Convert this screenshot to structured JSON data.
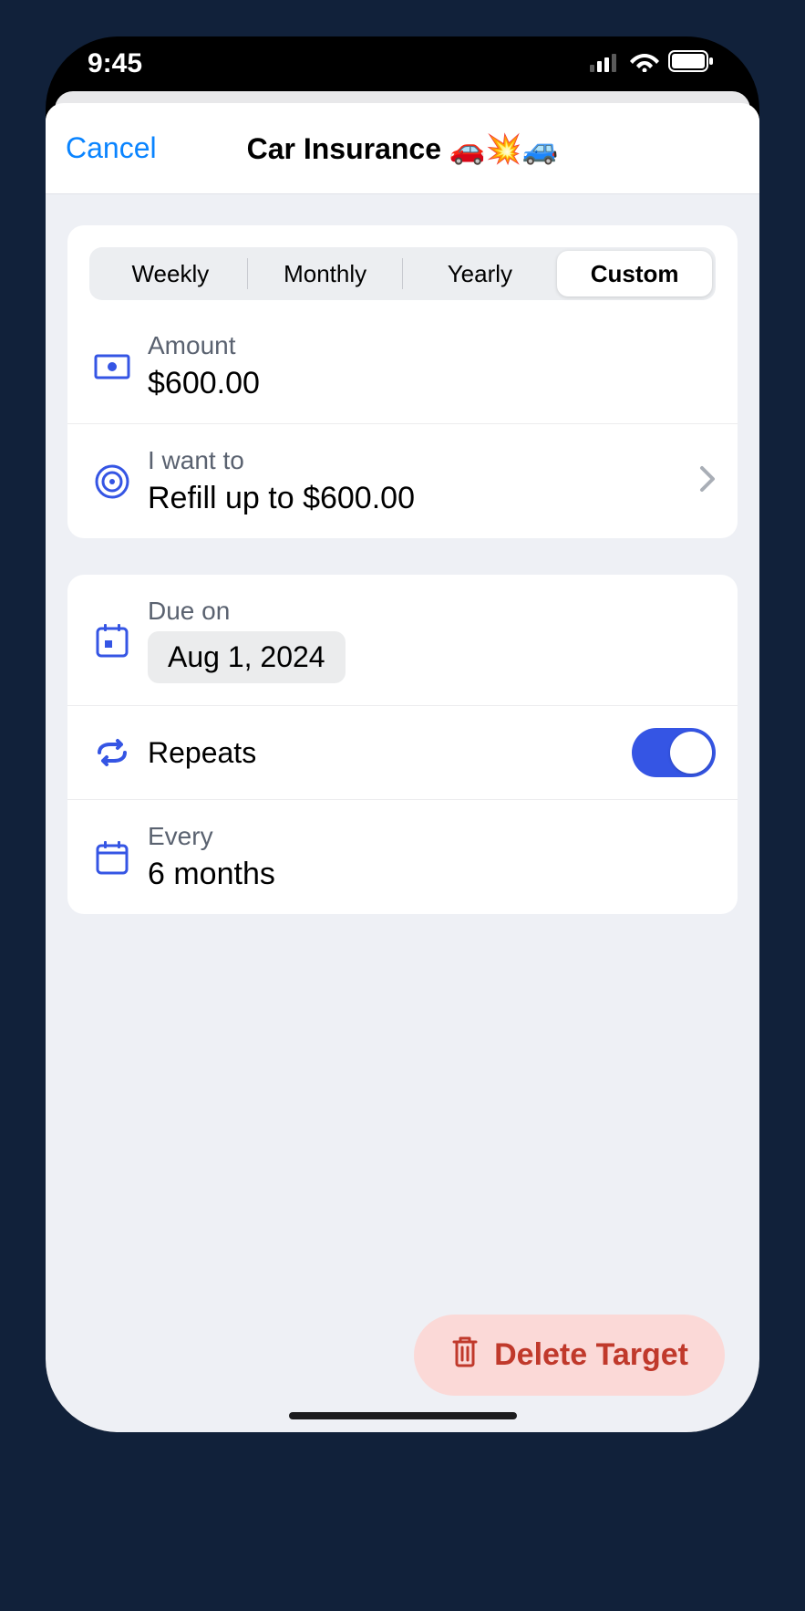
{
  "status": {
    "time": "9:45"
  },
  "sheet": {
    "cancel": "Cancel",
    "title": "Car Insurance 🚗💥🚙"
  },
  "segments": {
    "weekly": "Weekly",
    "monthly": "Monthly",
    "yearly": "Yearly",
    "custom": "Custom"
  },
  "amount": {
    "label": "Amount",
    "value": "$600.00"
  },
  "goal": {
    "label": "I want to",
    "value": "Refill up to $600.00"
  },
  "due": {
    "label": "Due on",
    "value": "Aug 1, 2024"
  },
  "repeats": {
    "label": "Repeats"
  },
  "every": {
    "label": "Every",
    "value": "6 months"
  },
  "delete": {
    "label": "Delete Target"
  }
}
